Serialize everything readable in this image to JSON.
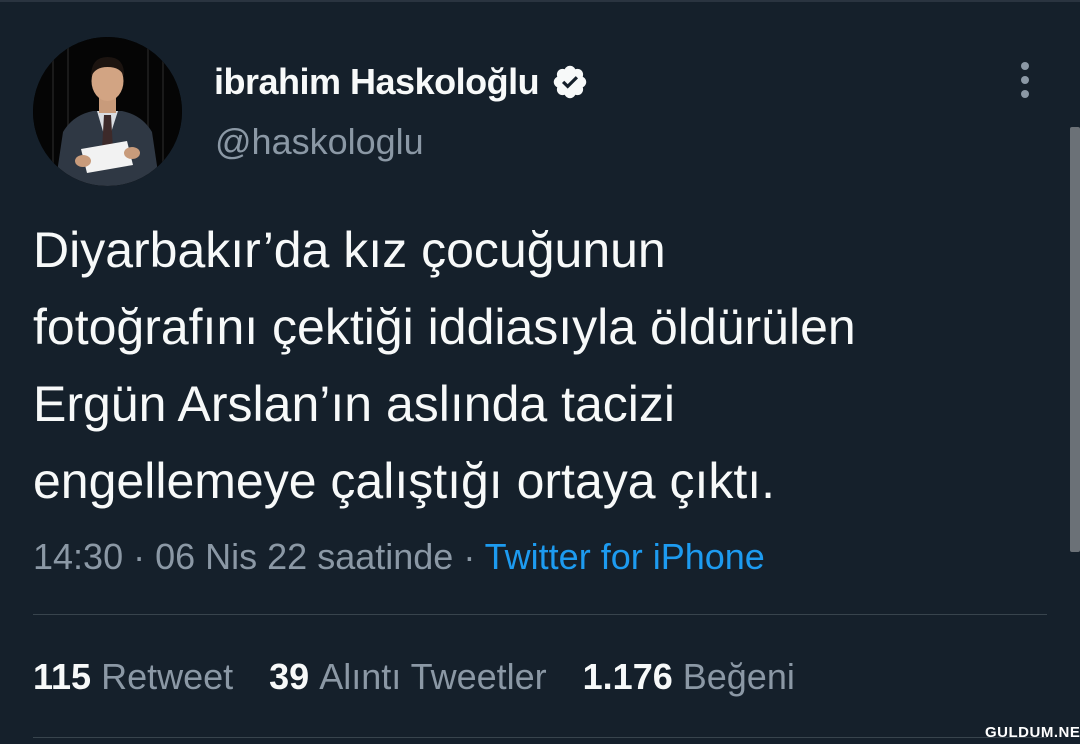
{
  "author": {
    "display_name": "ibrahim Haskoloğlu",
    "handle": "@haskologlu",
    "verified": true
  },
  "tweet": {
    "text_lines": [
      "Diyarbakır’da kız çocuğunun",
      "fotoğrafını çektiği iddiasıyla öldürülen",
      "Ergün Arslan’ın aslında tacizi",
      "engellemeye çalıştığı ortaya çıktı."
    ],
    "time": "14:30",
    "date": "06 Nis 22 saatinde",
    "separator": "·",
    "source": "Twitter for iPhone"
  },
  "stats": [
    {
      "count": "115",
      "label": "Retweet"
    },
    {
      "count": "39",
      "label": "Alıntı Tweetler"
    },
    {
      "count": "1.176",
      "label": "Beğeni"
    }
  ],
  "watermark": "GULDUM.NET",
  "icons": {
    "verified": "verified-badge-icon",
    "more": "more-options-icon"
  },
  "colors": {
    "background": "#15202b",
    "text_primary": "#f7f9f9",
    "text_secondary": "#8b98a5",
    "link": "#1d9bf0",
    "divider": "#38444d"
  }
}
